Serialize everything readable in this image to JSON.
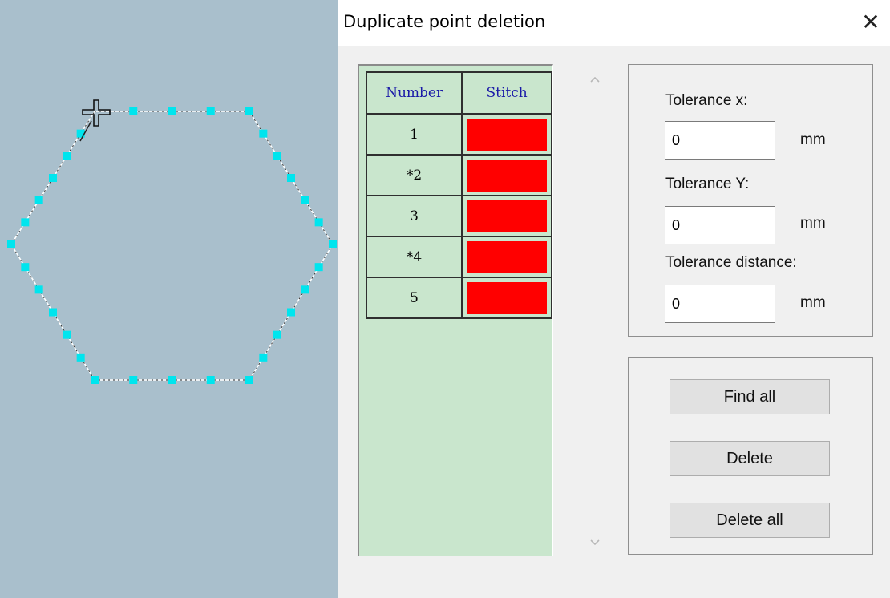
{
  "dialog": {
    "title": "Duplicate point deletion",
    "close_icon": "close-icon"
  },
  "table": {
    "headers": [
      "Number",
      "Stitch"
    ],
    "rows": [
      {
        "number": "1",
        "stitch_color": "#ff0000"
      },
      {
        "number": "*2",
        "stitch_color": "#ff0000"
      },
      {
        "number": "3",
        "stitch_color": "#ff0000"
      },
      {
        "number": "*4",
        "stitch_color": "#ff0000"
      },
      {
        "number": "5",
        "stitch_color": "#ff0000"
      }
    ]
  },
  "scrollbar": {
    "up_icon": "chevron-up-icon",
    "down_icon": "chevron-down-icon"
  },
  "tolerance": {
    "x_label": "Tolerance x:",
    "x_value": "0",
    "y_label": "Tolerance Y:",
    "y_value": "0",
    "distance_label": "Tolerance distance:",
    "distance_value": "0",
    "unit": "mm"
  },
  "buttons": {
    "find_all": "Find all",
    "delete": "Delete",
    "delete_all": "Delete all"
  },
  "colors": {
    "canvas_background": "#a9bfcc",
    "stitch_point": "#00e5ee",
    "stitch_line": "#ffffff",
    "list_background": "#c9e6cd",
    "header_text": "#1a1aa8"
  },
  "canvas": {
    "cursor_icon": "crosshair-cursor-icon"
  }
}
